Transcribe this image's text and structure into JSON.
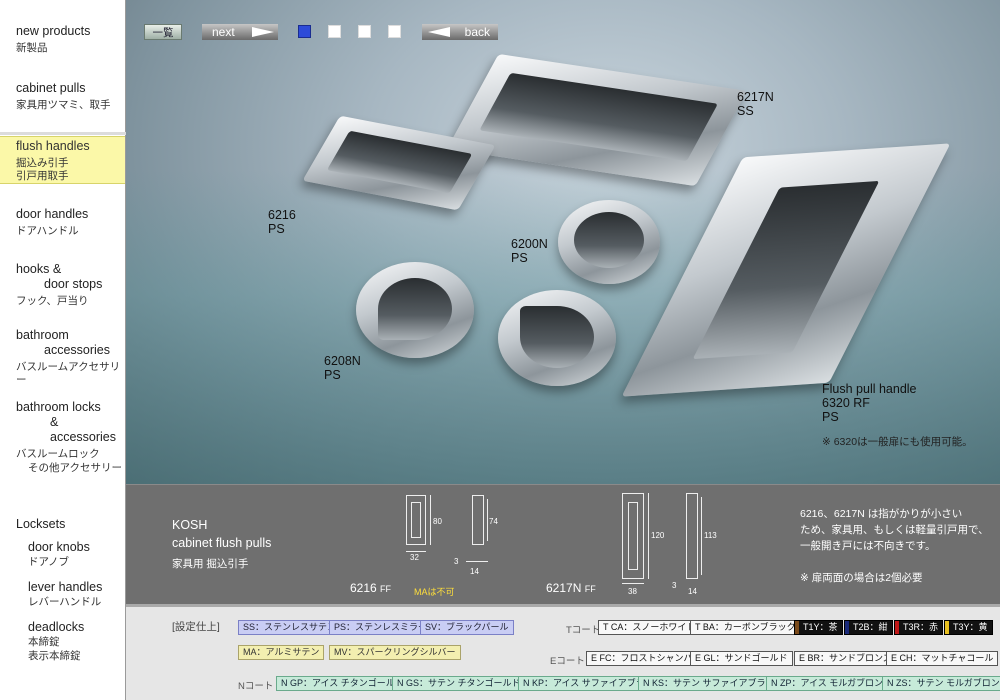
{
  "sidebar": {
    "new_products": {
      "en": "new products",
      "jp": "新製品"
    },
    "cabinet_pulls": {
      "en": "cabinet pulls",
      "jp": "家具用ツマミ、取手"
    },
    "flush_handles": {
      "en": "flush handles",
      "jp1": "掘込み引手",
      "jp2": "引戸用取手"
    },
    "door_handles": {
      "en": "door handles",
      "jp": "ドアハンドル"
    },
    "hooks": {
      "en1": "hooks &",
      "en2": "door stops",
      "jp": "フック、戸当り"
    },
    "bathroom": {
      "en1": "bathroom",
      "en2": "accessories",
      "jp": "バスルームアクセサリー"
    },
    "bathroom_locks": {
      "en1": "bathroom locks",
      "en2": "& accessories",
      "jp1": "バスルームロック",
      "jp2": "その他アクセサリー"
    },
    "locksets": {
      "en": "Locksets"
    },
    "door_knobs": {
      "en": "door knobs",
      "jp": "ドアノブ"
    },
    "lever_handles": {
      "en": "lever handles",
      "jp": "レバーハンドル"
    },
    "deadlocks": {
      "en": "deadlocks",
      "jp1": "本締錠",
      "jp2": "表示本締錠"
    }
  },
  "topnav": {
    "index": "一覧",
    "next": "next",
    "back": "back",
    "pages": 4,
    "current_page": 1
  },
  "photo_labels": {
    "p6217": {
      "model": "6217N",
      "finish": "SS"
    },
    "p6216": {
      "model": "6216",
      "finish": "PS"
    },
    "p6200": {
      "model": "6200N",
      "finish": "PS"
    },
    "p6208": {
      "model": "6208N",
      "finish": "PS"
    },
    "p6320": {
      "title": "Flush pull handle",
      "model": "6320 RF",
      "finish": "PS",
      "note": "※ 6320は一般扉にも使用可能。"
    }
  },
  "info": {
    "brand": "KOSH",
    "title": "cabinet flush pulls",
    "jp": "家具用 掘込引手",
    "d6216": {
      "w": "32",
      "h": "80",
      "h2": "74",
      "d1": "3",
      "d2": "14",
      "model": "6216",
      "ff": "FF",
      "ma": "MAは不可"
    },
    "d6217": {
      "w": "38",
      "h": "120",
      "h2": "113",
      "d1": "3",
      "d2": "14",
      "model": "6217N",
      "ff": "FF"
    },
    "note1": "6216、6217N は指がかりが小さい",
    "note2": "ため、家具用、もしくは軽量引戸用で、",
    "note3": "一般開き戸には不向きです。",
    "note4": "※ 扉両面の場合は2個必要"
  },
  "finishes": {
    "title": "[設定仕上]",
    "ss": "SS：ステンレスサテン",
    "ps": "PS：ステンレスミラー",
    "sv": "SV：ブラックパール",
    "ma": "MA：アルミサテン",
    "mv": "MV：スパークリングシルバー",
    "t_label": "Tコート",
    "tca": "T CA：スノーホワイト",
    "tba": "T BA：カーボンブラック",
    "t1y": "T1Y：茶",
    "t2b": "T2B：紺",
    "t3r": "T3R：赤",
    "t3y": "T3Y：黄",
    "e_label": "Eコート",
    "efc": "E FC：フロストシャンパン",
    "egl": "E GL：サンドゴールド",
    "ebr": "E BR：サンドブロンズ",
    "ech": "E CH：マットチャコール",
    "n_label": "Nコート",
    "ngp": "N GP：アイス チタンゴールド",
    "ngs": "N GS：サテン チタンゴールド",
    "nkp": "N KP：アイス サファイアブラック",
    "nks": "N KS：サテン サファイアブラック",
    "nzp": "N ZP：アイス モルガブロンズ",
    "nzs": "N ZS：サテン モルガブロンズ",
    "colors": {
      "t1y": "#7a4a1a",
      "t2b": "#1a2a7a",
      "t3r": "#c01818",
      "t3y": "#e8c020"
    }
  }
}
